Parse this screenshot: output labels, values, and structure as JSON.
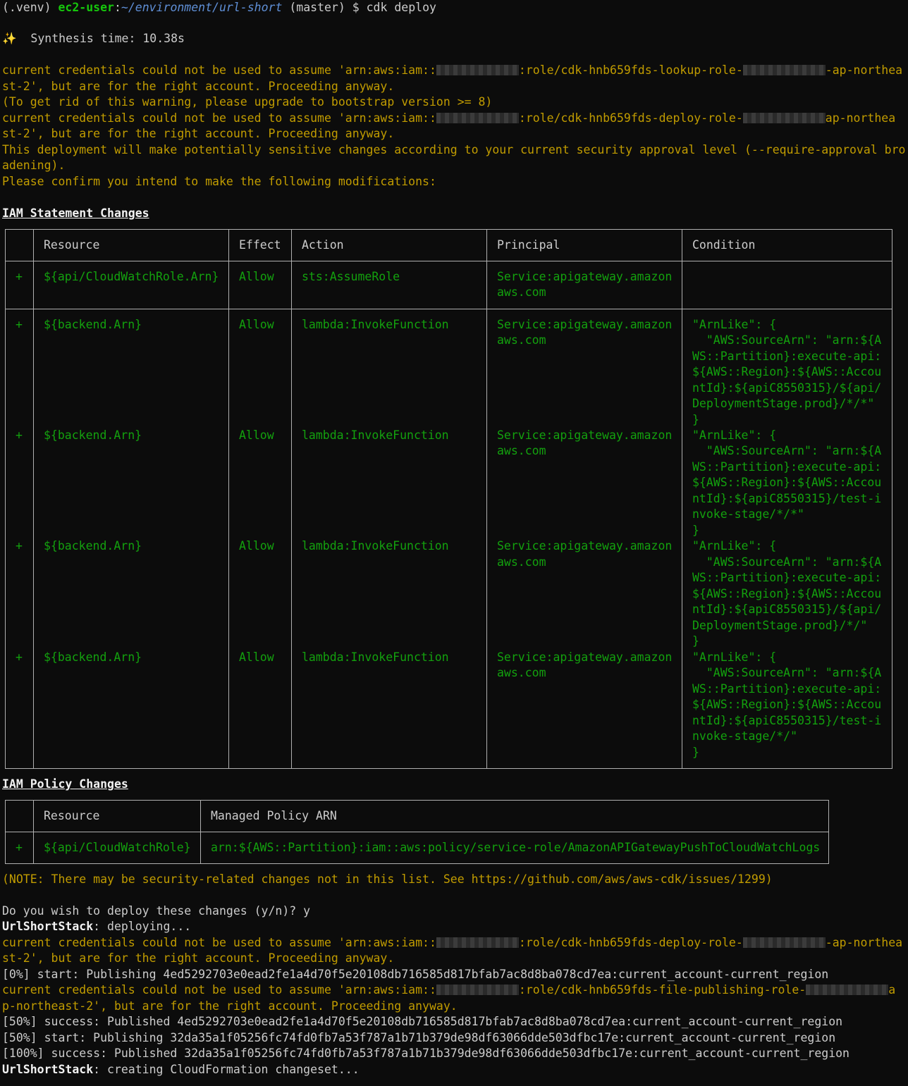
{
  "prompt": {
    "venv": "(.venv)",
    "user": "ec2-user",
    "sep": ":",
    "path": "~/environment/url-short",
    "branch": "(master)",
    "symbol": "$",
    "command": "cdk deploy"
  },
  "synth": {
    "icon": "✨",
    "text": "Synthesis time: 10.38s"
  },
  "warn1": {
    "a": "current credentials could not be used to assume 'arn:aws:iam::",
    "b": ":role/cdk-hnb659fds-lookup-role-",
    "c": "-ap-northea",
    "d": "st-2', but are for the right account. Proceeding anyway."
  },
  "bootstrap_note": "(To get rid of this warning, please upgrade to bootstrap version >= 8)",
  "warn2": {
    "a": "current credentials could not be used to assume 'arn:aws:iam::",
    "b": ":role/cdk-hnb659fds-deploy-role-",
    "c": "ap-northea",
    "d": "st-2', but are for the right account. Proceeding anyway."
  },
  "sensitive": {
    "line1": "This deployment will make potentially sensitive changes according to your current security approval level (--require-approval bro",
    "line2": "adening).",
    "confirm": "Please confirm you intend to make the following modifications:"
  },
  "iam_statements": {
    "heading": "IAM Statement Changes",
    "headers": {
      "resource": "Resource",
      "effect": "Effect",
      "action": "Action",
      "principal": "Principal",
      "condition": "Condition"
    },
    "rows": [
      {
        "sign": "+",
        "resource": "${api/CloudWatchRole.Arn}",
        "effect": "Allow",
        "action": "sts:AssumeRole",
        "principal": [
          "Service:apigateway.amazon",
          "aws.com"
        ],
        "condition": []
      },
      {
        "sign": "+",
        "resource": "${backend.Arn}",
        "effect": "Allow",
        "action": "lambda:InvokeFunction",
        "principal": [
          "Service:apigateway.amazon",
          "aws.com"
        ],
        "condition": [
          "\"ArnLike\": {",
          "  \"AWS:SourceArn\": \"arn:${A",
          "WS::Partition}:execute-api:",
          "${AWS::Region}:${AWS::Accou",
          "ntId}:${apiC8550315}/${api/",
          "DeploymentStage.prod}/*/*\"",
          "}"
        ]
      },
      {
        "sign": "+",
        "resource": "${backend.Arn}",
        "effect": "Allow",
        "action": "lambda:InvokeFunction",
        "principal": [
          "Service:apigateway.amazon",
          "aws.com"
        ],
        "condition": [
          "\"ArnLike\": {",
          "  \"AWS:SourceArn\": \"arn:${A",
          "WS::Partition}:execute-api:",
          "${AWS::Region}:${AWS::Accou",
          "ntId}:${apiC8550315}/test-i",
          "nvoke-stage/*/*\"",
          "}"
        ]
      },
      {
        "sign": "+",
        "resource": "${backend.Arn}",
        "effect": "Allow",
        "action": "lambda:InvokeFunction",
        "principal": [
          "Service:apigateway.amazon",
          "aws.com"
        ],
        "condition": [
          "\"ArnLike\": {",
          "  \"AWS:SourceArn\": \"arn:${A",
          "WS::Partition}:execute-api:",
          "${AWS::Region}:${AWS::Accou",
          "ntId}:${apiC8550315}/${api/",
          "DeploymentStage.prod}/*/\"",
          "}"
        ]
      },
      {
        "sign": "+",
        "resource": "${backend.Arn}",
        "effect": "Allow",
        "action": "lambda:InvokeFunction",
        "principal": [
          "Service:apigateway.amazon",
          "aws.com"
        ],
        "condition": [
          "\"ArnLike\": {",
          "  \"AWS:SourceArn\": \"arn:${A",
          "WS::Partition}:execute-api:",
          "${AWS::Region}:${AWS::Accou",
          "ntId}:${apiC8550315}/test-i",
          "nvoke-stage/*/\"",
          "}"
        ]
      }
    ]
  },
  "iam_policies": {
    "heading": "IAM Policy Changes",
    "headers": {
      "resource": "Resource",
      "arn": "Managed Policy ARN"
    },
    "rows": [
      {
        "sign": "+",
        "resource": "${api/CloudWatchRole}",
        "arn": "arn:${AWS::Partition}:iam::aws:policy/service-role/AmazonAPIGatewayPushToCloudWatchLogs"
      }
    ]
  },
  "note": "(NOTE: There may be security-related changes not in this list. See https://github.com/aws/aws-cdk/issues/1299)",
  "deploy_question": "Do you wish to deploy these changes (y/n)? y",
  "stack_name": "UrlShortStack",
  "deploying": ": deploying...",
  "warn3": {
    "a": "current credentials could not be used to assume 'arn:aws:iam::",
    "b": ":role/cdk-hnb659fds-deploy-role-",
    "c": "-ap-northea",
    "d": "st-2', but are for the right account. Proceeding anyway."
  },
  "pub0": "[0%] start: Publishing 4ed5292703e0ead2fe1a4d70f5e20108db716585d817bfab7ac8d8ba078cd7ea:current_account-current_region",
  "warn4": {
    "a": "current credentials could not be used to assume 'arn:aws:iam::",
    "b": ":role/cdk-hnb659fds-file-publishing-role-",
    "c": "a",
    "d": "p-northeast-2', but are for the right account. Proceeding anyway."
  },
  "pub50a": "[50%] success: Published 4ed5292703e0ead2fe1a4d70f5e20108db716585d817bfab7ac8d8ba078cd7ea:current_account-current_region",
  "pub50b": "[50%] start: Publishing 32da35a1f05256fc74fd0fb7a53f787a1b71b379de98df63066dde503dfbc17e:current_account-current_region",
  "pub100": "[100%] success: Published 32da35a1f05256fc74fd0fb7a53f787a1b71b379de98df63066dde503dfbc17e:current_account-current_region",
  "changeset": ": creating CloudFormation changeset..."
}
